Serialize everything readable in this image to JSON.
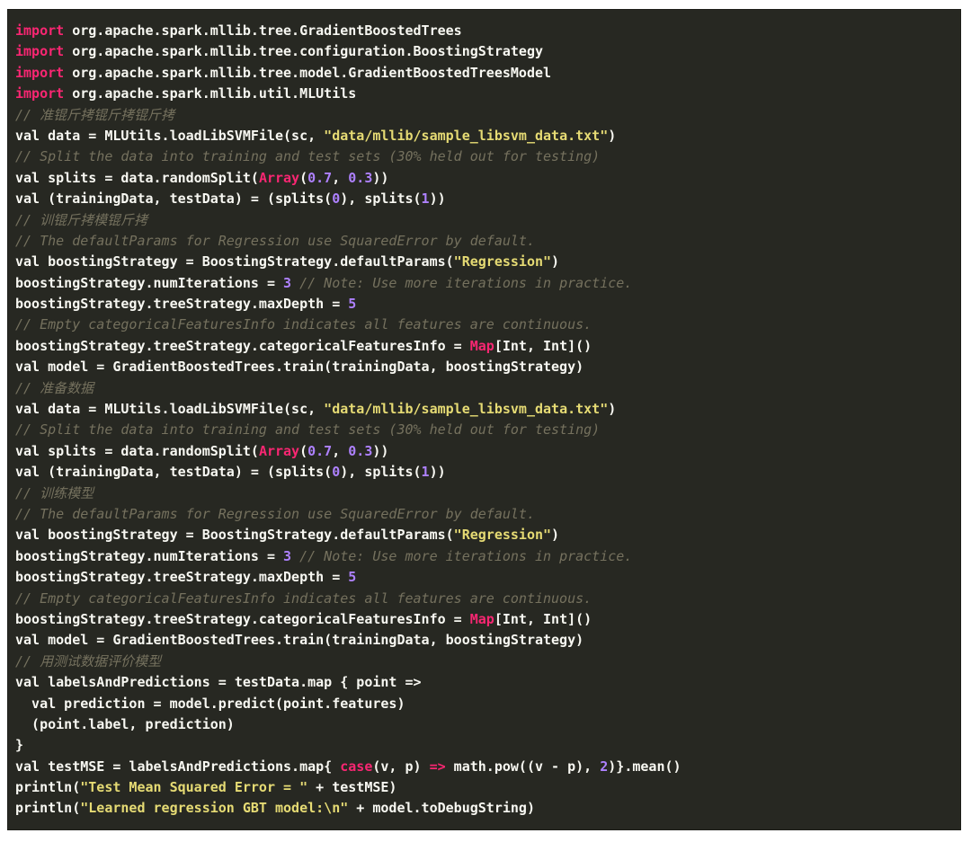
{
  "lines": [
    [
      [
        "kw",
        "import"
      ],
      [
        "plain",
        " org.apache.spark.mllib.tree.GradientBoostedTrees"
      ]
    ],
    [
      [
        "kw",
        "import"
      ],
      [
        "plain",
        " org.apache.spark.mllib.tree.configuration.BoostingStrategy"
      ]
    ],
    [
      [
        "kw",
        "import"
      ],
      [
        "plain",
        " org.apache.spark.mllib.tree.model.GradientBoostedTreesModel"
      ]
    ],
    [
      [
        "kw",
        "import"
      ],
      [
        "plain",
        " org.apache.spark.mllib.util.MLUtils"
      ]
    ],
    [
      [
        "com",
        "// 准锟斤拷锟斤拷锟斤拷"
      ]
    ],
    [
      [
        "plain",
        "val data = MLUtils.loadLibSVMFile(sc, "
      ],
      [
        "str",
        "\"data/mllib/sample_libsvm_data.txt\""
      ],
      [
        "plain",
        ")"
      ]
    ],
    [
      [
        "com",
        "// Split the data into training and test sets (30% held out for testing)"
      ]
    ],
    [
      [
        "plain",
        "val splits = data.randomSplit("
      ],
      [
        "kw",
        "Array"
      ],
      [
        "plain",
        "("
      ],
      [
        "num",
        "0.7"
      ],
      [
        "plain",
        ", "
      ],
      [
        "num",
        "0.3"
      ],
      [
        "plain",
        "))"
      ]
    ],
    [
      [
        "plain",
        "val (trainingData, testData) = (splits("
      ],
      [
        "num",
        "0"
      ],
      [
        "plain",
        "), splits("
      ],
      [
        "num",
        "1"
      ],
      [
        "plain",
        "))"
      ]
    ],
    [
      [
        "com",
        "// 训锟斤拷模锟斤拷"
      ]
    ],
    [
      [
        "com",
        "// The defaultParams for Regression use SquaredError by default."
      ]
    ],
    [
      [
        "plain",
        "val boostingStrategy = BoostingStrategy.defaultParams("
      ],
      [
        "str",
        "\"Regression\""
      ],
      [
        "plain",
        ")"
      ]
    ],
    [
      [
        "plain",
        "boostingStrategy.numIterations = "
      ],
      [
        "num",
        "3"
      ],
      [
        "plain",
        " "
      ],
      [
        "com",
        "// Note: Use more iterations in practice."
      ]
    ],
    [
      [
        "plain",
        "boostingStrategy.treeStrategy.maxDepth = "
      ],
      [
        "num",
        "5"
      ]
    ],
    [
      [
        "com",
        "// Empty categoricalFeaturesInfo indicates all features are continuous."
      ]
    ],
    [
      [
        "plain",
        "boostingStrategy.treeStrategy.categoricalFeaturesInfo = "
      ],
      [
        "kw",
        "Map"
      ],
      [
        "plain",
        "[Int, Int]()"
      ]
    ],
    [
      [
        "plain",
        "val model = GradientBoostedTrees.train(trainingData, boostingStrategy)"
      ]
    ],
    [
      [
        "com",
        "// 准备数据"
      ]
    ],
    [
      [
        "plain",
        "val data = MLUtils.loadLibSVMFile(sc, "
      ],
      [
        "str",
        "\"data/mllib/sample_libsvm_data.txt\""
      ],
      [
        "plain",
        ")"
      ]
    ],
    [
      [
        "com",
        "// Split the data into training and test sets (30% held out for testing)"
      ]
    ],
    [
      [
        "plain",
        "val splits = data.randomSplit("
      ],
      [
        "kw",
        "Array"
      ],
      [
        "plain",
        "("
      ],
      [
        "num",
        "0.7"
      ],
      [
        "plain",
        ", "
      ],
      [
        "num",
        "0.3"
      ],
      [
        "plain",
        "))"
      ]
    ],
    [
      [
        "plain",
        "val (trainingData, testData) = (splits("
      ],
      [
        "num",
        "0"
      ],
      [
        "plain",
        "), splits("
      ],
      [
        "num",
        "1"
      ],
      [
        "plain",
        "))"
      ]
    ],
    [
      [
        "com",
        "// 训练模型"
      ]
    ],
    [
      [
        "com",
        "// The defaultParams for Regression use SquaredError by default."
      ]
    ],
    [
      [
        "plain",
        "val boostingStrategy = BoostingStrategy.defaultParams("
      ],
      [
        "str",
        "\"Regression\""
      ],
      [
        "plain",
        ")"
      ]
    ],
    [
      [
        "plain",
        "boostingStrategy.numIterations = "
      ],
      [
        "num",
        "3"
      ],
      [
        "plain",
        " "
      ],
      [
        "com",
        "// Note: Use more iterations in practice."
      ]
    ],
    [
      [
        "plain",
        "boostingStrategy.treeStrategy.maxDepth = "
      ],
      [
        "num",
        "5"
      ]
    ],
    [
      [
        "com",
        "// Empty categoricalFeaturesInfo indicates all features are continuous."
      ]
    ],
    [
      [
        "plain",
        "boostingStrategy.treeStrategy.categoricalFeaturesInfo = "
      ],
      [
        "kw",
        "Map"
      ],
      [
        "plain",
        "[Int, Int]()"
      ]
    ],
    [
      [
        "plain",
        "val model = GradientBoostedTrees.train(trainingData, boostingStrategy)"
      ]
    ],
    [
      [
        "com",
        "// 用测试数据评价模型"
      ]
    ],
    [
      [
        "plain",
        "val labelsAndPredictions = testData.map { point =>"
      ]
    ],
    [
      [
        "plain",
        "  val prediction = model.predict(point.features)"
      ]
    ],
    [
      [
        "plain",
        "  (point.label, prediction)"
      ]
    ],
    [
      [
        "plain",
        "}"
      ]
    ],
    [
      [
        "plain",
        "val testMSE = labelsAndPredictions.map{ "
      ],
      [
        "kw",
        "case"
      ],
      [
        "plain",
        "(v, p) "
      ],
      [
        "kw",
        "=>"
      ],
      [
        "plain",
        " math.pow((v - p), "
      ],
      [
        "num",
        "2"
      ],
      [
        "plain",
        ")}.mean()"
      ]
    ],
    [
      [
        "plain",
        "println("
      ],
      [
        "str",
        "\"Test Mean Squared Error = \""
      ],
      [
        "plain",
        " + testMSE)"
      ]
    ],
    [
      [
        "plain",
        "println("
      ],
      [
        "str",
        "\"Learned regression GBT model:\\n\""
      ],
      [
        "plain",
        " + model.toDebugString)"
      ]
    ]
  ],
  "colors": {
    "background": "#272822",
    "plain": "#f8f8f2",
    "keyword": "#f92672",
    "string": "#e6db74",
    "number": "#ae81ff",
    "comment": "#75715e"
  }
}
